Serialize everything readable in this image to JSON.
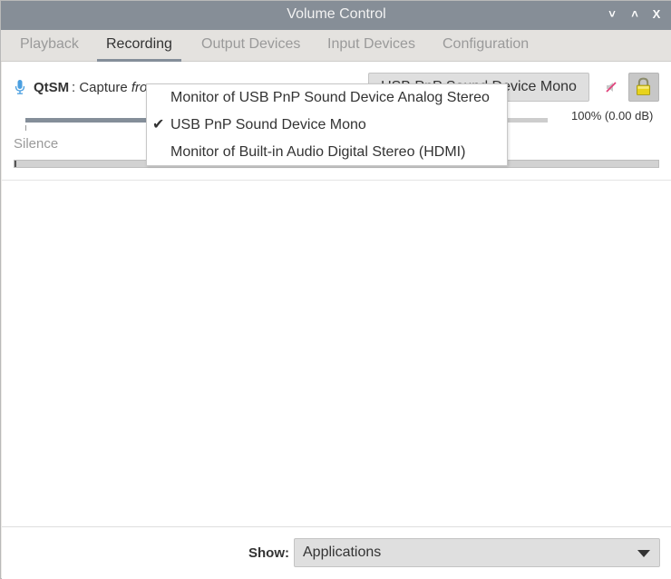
{
  "window": {
    "title": "Volume Control",
    "controls": {
      "minimize": "˅",
      "maximize": "˄",
      "close": "X"
    }
  },
  "tabs": [
    {
      "label": "Playback",
      "active": false
    },
    {
      "label": "Recording",
      "active": true
    },
    {
      "label": "Output Devices",
      "active": false
    },
    {
      "label": "Input Devices",
      "active": false
    },
    {
      "label": "Configuration",
      "active": false
    }
  ],
  "stream": {
    "icon": "microphone-icon",
    "app_name": "QtSM",
    "separator": ": Capture ",
    "from_text": "fro",
    "device_button": "USB PnP Sound Device Mono",
    "mute_icon": "audio-volume-muted-icon",
    "lock_icon": "lock-icon",
    "volume_percent": 100,
    "volume_text": "100% (0.00 dB)",
    "silence_label": "Silence",
    "level_fraction": 0.0
  },
  "device_popup": {
    "items": [
      {
        "label": "Monitor of USB PnP Sound Device Analog Stereo",
        "checked": false,
        "check": ""
      },
      {
        "label": "USB PnP Sound Device Mono",
        "checked": true,
        "check": "✔"
      },
      {
        "label": "Monitor of Built-in Audio Digital Stereo (HDMI)",
        "checked": false,
        "check": ""
      }
    ]
  },
  "footer": {
    "show_label": "Show:",
    "show_value": "Applications"
  },
  "colors": {
    "titlebar": "#868e97",
    "accent": "#848e99",
    "mic_blue": "#4a9fe0",
    "lock_yellow": "#e8d31c"
  }
}
